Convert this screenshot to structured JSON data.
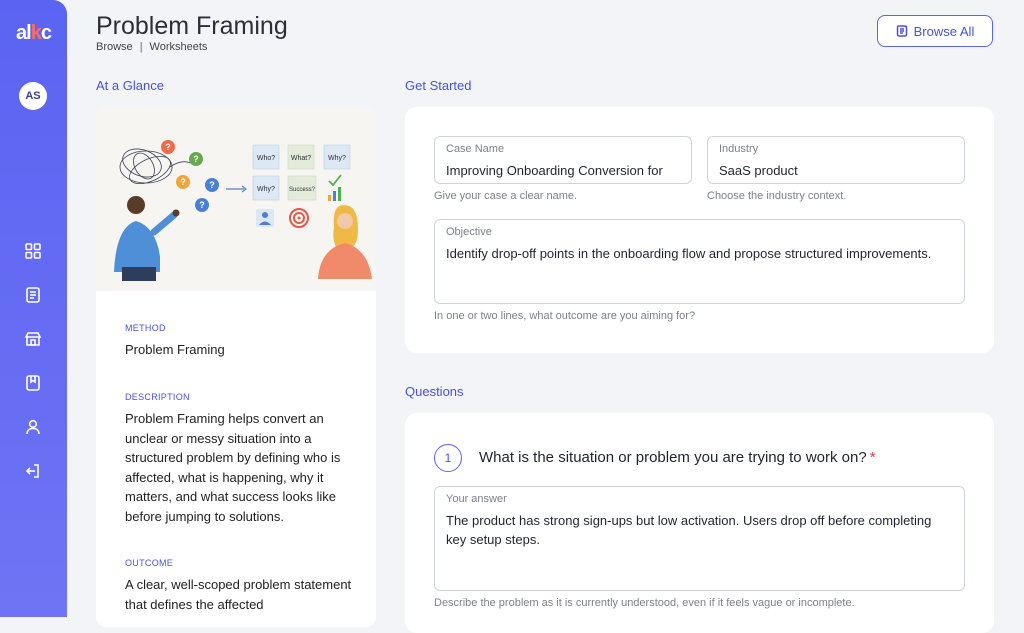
{
  "brand": {
    "logo_a": "al",
    "logo_k": "k",
    "logo_c": "c"
  },
  "user": {
    "initials": "AS"
  },
  "sidebar": {
    "items": [
      {
        "icon": "grid-icon"
      },
      {
        "icon": "worksheet-icon"
      },
      {
        "icon": "store-icon"
      },
      {
        "icon": "bookmark-icon"
      },
      {
        "icon": "user-icon"
      },
      {
        "icon": "logout-icon"
      }
    ]
  },
  "header": {
    "title": "Problem Framing",
    "breadcrumb": [
      "Browse",
      "|",
      "Worksheets"
    ],
    "browse_all": "Browse All"
  },
  "glance": {
    "label": "At a Glance",
    "illustration_notes": [
      "Who?",
      "What?",
      "Why?",
      "Why?",
      "Success?"
    ],
    "method_label": "METHOD",
    "method": "Problem Framing",
    "description_label": "DESCRIPTION",
    "description": "Problem Framing helps convert an unclear or messy situation into a structured problem by defining who is affected, what is happening, why it matters, and what success looks like before jumping to solutions.",
    "outcome_label": "OUTCOME",
    "outcome": "A clear, well-scoped problem statement that defines the affected"
  },
  "get_started": {
    "label": "Get Started",
    "case_name": {
      "label": "Case Name",
      "value": "Improving Onboarding Conversion for",
      "hint": "Give your case a clear name."
    },
    "industry": {
      "label": "Industry",
      "value": "SaaS product",
      "hint": "Choose the industry context."
    },
    "objective": {
      "label": "Objective",
      "value": "Identify drop-off points in the onboarding flow and propose structured improvements.",
      "hint": "In one or two lines, what outcome are you aiming for?"
    }
  },
  "questions": {
    "label": "Questions",
    "items": [
      {
        "number": "1",
        "text": "What is the situation or problem you are trying to work on?",
        "required_mark": "*",
        "answer_label": "Your answer",
        "answer": "The product has strong sign-ups but low activation. Users drop off before completing key setup steps.",
        "hint": "Describe the problem as it is currently understood, even if it feels vague or incomplete."
      }
    ]
  },
  "colors": {
    "accent": "#5b63f2",
    "required": "#e53935"
  }
}
